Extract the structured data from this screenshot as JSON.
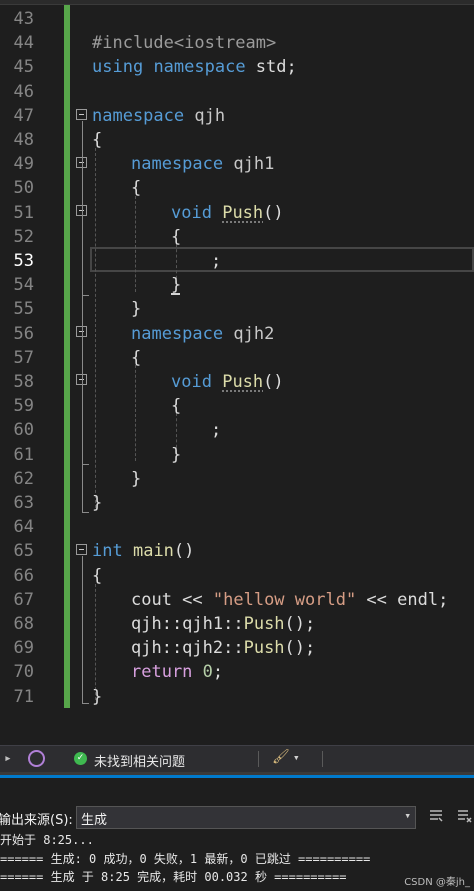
{
  "editor": {
    "active_line": "53",
    "lines": [
      {
        "n": "43",
        "tokens": []
      },
      {
        "n": "44",
        "tokens": [
          {
            "t": "#include<iostream>",
            "c": "pp"
          }
        ]
      },
      {
        "n": "45",
        "tokens": [
          {
            "t": "using",
            "c": "kw"
          },
          {
            "t": " "
          },
          {
            "t": "namespace",
            "c": "kw"
          },
          {
            "t": " std;"
          }
        ]
      },
      {
        "n": "46",
        "tokens": []
      },
      {
        "n": "47",
        "tokens": [
          {
            "t": "namespace",
            "c": "kw"
          },
          {
            "t": " qjh",
            "c": "ns"
          }
        ]
      },
      {
        "n": "48",
        "tokens": [
          {
            "t": "{"
          }
        ]
      },
      {
        "n": "49",
        "tokens": [
          {
            "t": "namespace",
            "c": "kw"
          },
          {
            "t": " qjh1",
            "c": "ns"
          }
        ]
      },
      {
        "n": "50",
        "tokens": [
          {
            "t": "{"
          }
        ]
      },
      {
        "n": "51",
        "tokens": [
          {
            "t": "void",
            "c": "kw"
          },
          {
            "t": " "
          },
          {
            "t": "Push",
            "c": "fn squig"
          },
          {
            "t": "()"
          }
        ]
      },
      {
        "n": "52",
        "tokens": [
          {
            "t": "{"
          }
        ]
      },
      {
        "n": "53",
        "tokens": [
          {
            "t": ";"
          }
        ]
      },
      {
        "n": "54",
        "tokens": [
          {
            "t": "}"
          }
        ]
      },
      {
        "n": "55",
        "tokens": [
          {
            "t": "}"
          }
        ]
      },
      {
        "n": "56",
        "tokens": [
          {
            "t": "namespace",
            "c": "kw"
          },
          {
            "t": " qjh2",
            "c": "ns"
          }
        ]
      },
      {
        "n": "57",
        "tokens": [
          {
            "t": "{"
          }
        ]
      },
      {
        "n": "58",
        "tokens": [
          {
            "t": "void",
            "c": "kw"
          },
          {
            "t": " "
          },
          {
            "t": "Push",
            "c": "fn squig"
          },
          {
            "t": "()"
          }
        ]
      },
      {
        "n": "59",
        "tokens": [
          {
            "t": "{"
          }
        ]
      },
      {
        "n": "60",
        "tokens": [
          {
            "t": ";"
          }
        ]
      },
      {
        "n": "61",
        "tokens": [
          {
            "t": "}"
          }
        ]
      },
      {
        "n": "62",
        "tokens": [
          {
            "t": "}"
          }
        ]
      },
      {
        "n": "63",
        "tokens": [
          {
            "t": "}"
          }
        ]
      },
      {
        "n": "64",
        "tokens": []
      },
      {
        "n": "65",
        "tokens": [
          {
            "t": "int",
            "c": "kw"
          },
          {
            "t": " "
          },
          {
            "t": "main",
            "c": "fn"
          },
          {
            "t": "()"
          }
        ]
      },
      {
        "n": "66",
        "tokens": [
          {
            "t": "{"
          }
        ]
      },
      {
        "n": "67",
        "tokens": [
          {
            "t": "cout << "
          },
          {
            "t": "\"hellow world\"",
            "c": "str"
          },
          {
            "t": " << endl;"
          }
        ]
      },
      {
        "n": "68",
        "tokens": [
          {
            "t": "qjh::qjh1::"
          },
          {
            "t": "Push",
            "c": "fn"
          },
          {
            "t": "();"
          }
        ]
      },
      {
        "n": "69",
        "tokens": [
          {
            "t": "qjh::qjh2::"
          },
          {
            "t": "Push",
            "c": "fn"
          },
          {
            "t": "();"
          }
        ]
      },
      {
        "n": "70",
        "tokens": [
          {
            "t": "return",
            "c": "ret"
          },
          {
            "t": " "
          },
          {
            "t": "0",
            "c": "num"
          },
          {
            "t": ";"
          }
        ]
      },
      {
        "n": "71",
        "tokens": [
          {
            "t": "}"
          }
        ]
      }
    ]
  },
  "status_bar": {
    "issues_text": "未找到相关问题",
    "ok_glyph": "✓",
    "brush_glyph": "🖌",
    "dropdown_glyph": "▾",
    "left_glyph": "▸"
  },
  "output": {
    "source_label": "输出来源(S):",
    "source_value": "生成",
    "source_arrow": "▾",
    "log": [
      "开始于 8:25...",
      "====== 生成: 0 成功，0 失败，1 最新，0 已跳过 ==========",
      "====== 生成 于 8:25 完成，耗时 00.032 秒 =========="
    ],
    "watermark": "CSDN @秦jh_"
  },
  "colors": {
    "editor_bg": "#1e1e1e",
    "keyword": "#569cd6",
    "string": "#d69d85",
    "function": "#dcdcaa",
    "change_bar": "#57a64a",
    "accent": "#007acc"
  }
}
